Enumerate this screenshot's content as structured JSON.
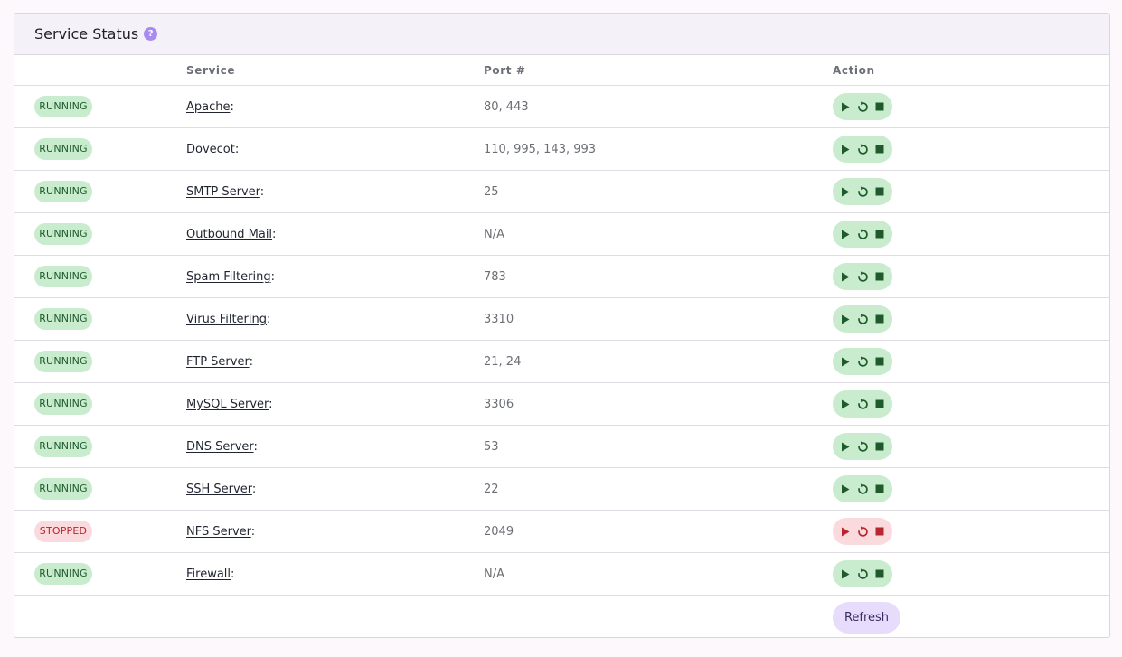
{
  "panel": {
    "title": "Service Status",
    "help_glyph": "?"
  },
  "columns": {
    "status": "",
    "service": "Service",
    "port": "Port #",
    "action": "Action"
  },
  "colors": {
    "running_bg": "#c9ecce",
    "running_fg": "#1e5a2a",
    "stopped_bg": "#fadadd",
    "stopped_fg": "#b5262e",
    "accent": "#a78bf0"
  },
  "services": [
    {
      "status": "RUNNING",
      "name": "Apache",
      "port": "80, 443"
    },
    {
      "status": "RUNNING",
      "name": "Dovecot",
      "port": "110, 995, 143, 993"
    },
    {
      "status": "RUNNING",
      "name": "SMTP Server",
      "port": "25"
    },
    {
      "status": "RUNNING",
      "name": "Outbound Mail",
      "port": "N/A"
    },
    {
      "status": "RUNNING",
      "name": "Spam Filtering",
      "port": "783"
    },
    {
      "status": "RUNNING",
      "name": "Virus Filtering",
      "port": "3310"
    },
    {
      "status": "RUNNING",
      "name": "FTP Server",
      "port": "21, 24"
    },
    {
      "status": "RUNNING",
      "name": "MySQL Server",
      "port": "3306"
    },
    {
      "status": "RUNNING",
      "name": "DNS Server",
      "port": "53"
    },
    {
      "status": "RUNNING",
      "name": "SSH Server",
      "port": "22"
    },
    {
      "status": "STOPPED",
      "name": "NFS Server",
      "port": "2049"
    },
    {
      "status": "RUNNING",
      "name": "Firewall",
      "port": "N/A"
    }
  ],
  "actions": {
    "icons": [
      "play-icon",
      "restart-icon",
      "stop-icon"
    ]
  },
  "footer": {
    "refresh_label": "Refresh"
  }
}
